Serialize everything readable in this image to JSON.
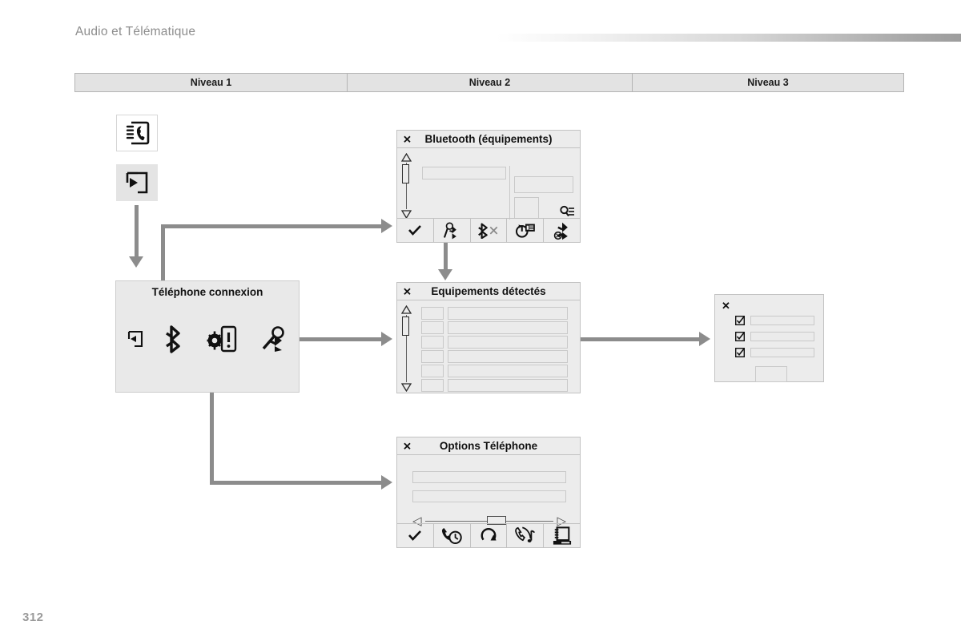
{
  "page": {
    "header_title": "Audio et Télématique",
    "page_number": "312",
    "accent_gradient_from": "#ffffff",
    "accent_gradient_to": "#9d9d9d",
    "background": "#ffffff"
  },
  "levels": [
    {
      "label": "Niveau 1"
    },
    {
      "label": "Niveau 2"
    },
    {
      "label": "Niveau 3"
    }
  ],
  "tiles": [
    {
      "name": "phonebook-icon",
      "label": ""
    },
    {
      "name": "enter-arrow-icon",
      "label": ""
    }
  ],
  "connection_panel": {
    "title": "Téléphone connexion",
    "icons": [
      {
        "name": "exit-arrow-icon"
      },
      {
        "name": "bluetooth-icon"
      },
      {
        "name": "phone-settings-icon"
      },
      {
        "name": "bluetooth-search-icon"
      }
    ]
  },
  "bluetooth_dialog": {
    "title": "Bluetooth (équipements)",
    "close_label": "✕",
    "search_icon": "magnifier-list-icon",
    "toolbar": [
      {
        "name": "validate-check-icon"
      },
      {
        "name": "bluetooth-search-icon"
      },
      {
        "name": "bluetooth-disconnect-icon"
      },
      {
        "name": "contacts-sync-icon"
      },
      {
        "name": "bluetooth-remove-icon"
      }
    ]
  },
  "detected_dialog": {
    "title": "Equipements détectés",
    "close_label": "✕",
    "row_count": 6
  },
  "niveau3_dialog": {
    "close_label": "✕",
    "rows": [
      {
        "checkbox": "checkbox-checked-icon"
      },
      {
        "checkbox": "checkbox-checked-icon"
      },
      {
        "checkbox": "checkbox-checked-icon"
      }
    ]
  },
  "options_dialog": {
    "title": "Options Téléphone",
    "close_label": "✕",
    "slider": {
      "left_arrow": "◁",
      "right_arrow": "▷",
      "value_percent": 52
    },
    "toolbar": [
      {
        "name": "validate-check-icon"
      },
      {
        "name": "call-duration-icon"
      },
      {
        "name": "loop-refresh-icon"
      },
      {
        "name": "ringtone-icon"
      },
      {
        "name": "phonebook-device-icon"
      }
    ]
  }
}
